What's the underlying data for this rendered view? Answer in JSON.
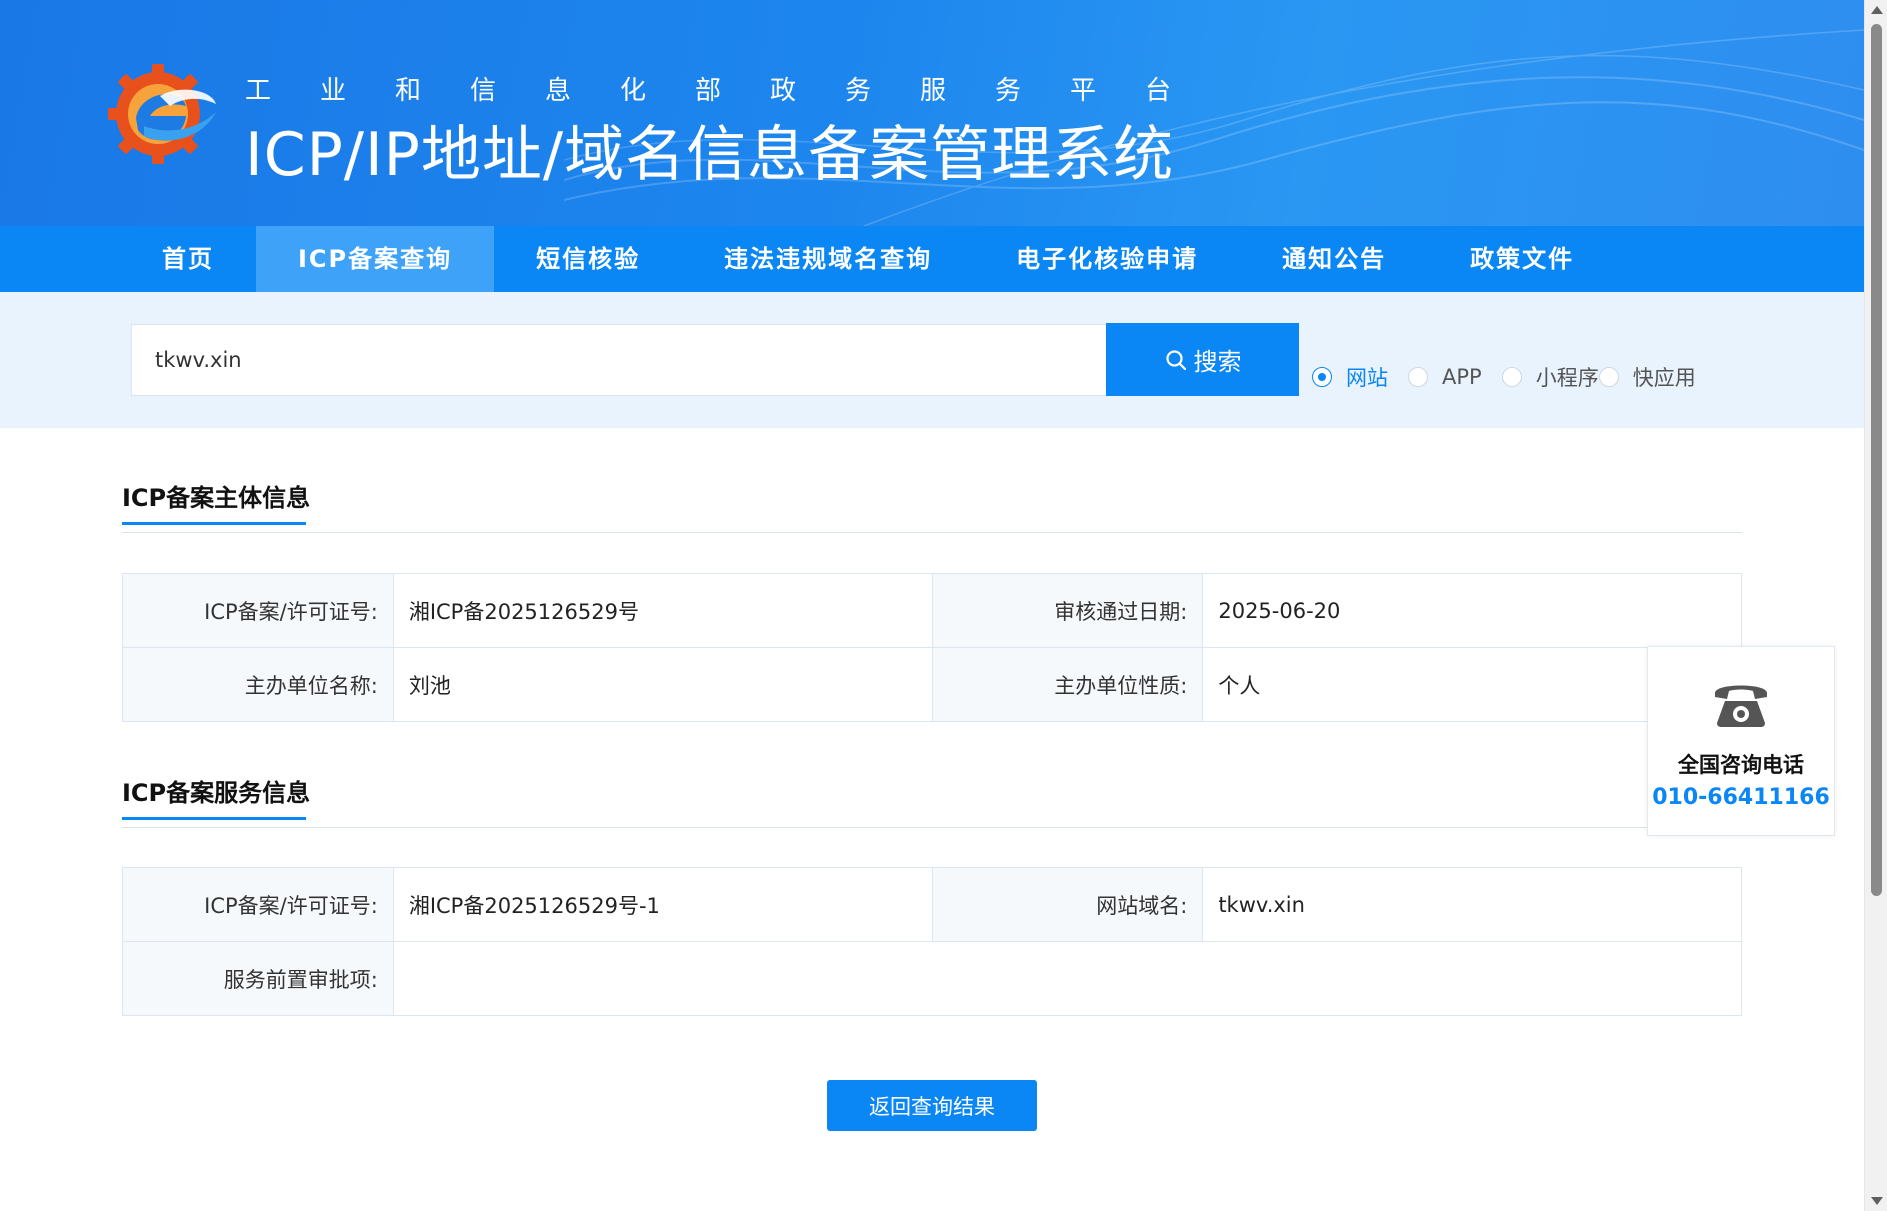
{
  "header": {
    "subtitle": "工业和信息化部政务服务平台",
    "title": "ICP/IP地址/域名信息备案管理系统"
  },
  "nav": {
    "items": [
      {
        "label": "首页"
      },
      {
        "label": "ICP备案查询",
        "active": true
      },
      {
        "label": "短信核验"
      },
      {
        "label": "违法违规域名查询"
      },
      {
        "label": "电子化核验申请"
      },
      {
        "label": "通知公告"
      },
      {
        "label": "政策文件"
      }
    ]
  },
  "search": {
    "value": "tkwv.xin",
    "button_label": "搜索",
    "types": [
      {
        "label": "网站",
        "checked": true
      },
      {
        "label": "APP",
        "checked": false
      },
      {
        "label": "小程序",
        "checked": false
      },
      {
        "label": "快应用",
        "checked": false
      }
    ]
  },
  "subject_info": {
    "title": "ICP备案主体信息",
    "license_label": "ICP备案/许可证号:",
    "license_value": "湘ICP备2025126529号",
    "approval_date_label": "审核通过日期:",
    "approval_date_value": "2025-06-20",
    "org_name_label": "主办单位名称:",
    "org_name_value": "刘池",
    "org_type_label": "主办单位性质:",
    "org_type_value": "个人"
  },
  "service_info": {
    "title": "ICP备案服务信息",
    "license_label": "ICP备案/许可证号:",
    "license_value": "湘ICP备2025126529号-1",
    "domain_label": "网站域名:",
    "domain_value": "tkwv.xin",
    "pre_approval_label": "服务前置审批项:",
    "pre_approval_value": ""
  },
  "back_button_label": "返回查询结果",
  "consult": {
    "icon": "phone-icon",
    "label": "全国咨询电话",
    "number": "010-66411166"
  },
  "colors": {
    "primary": "#0b86f5",
    "header": "#1d86ee",
    "band": "#e9f3fd"
  }
}
